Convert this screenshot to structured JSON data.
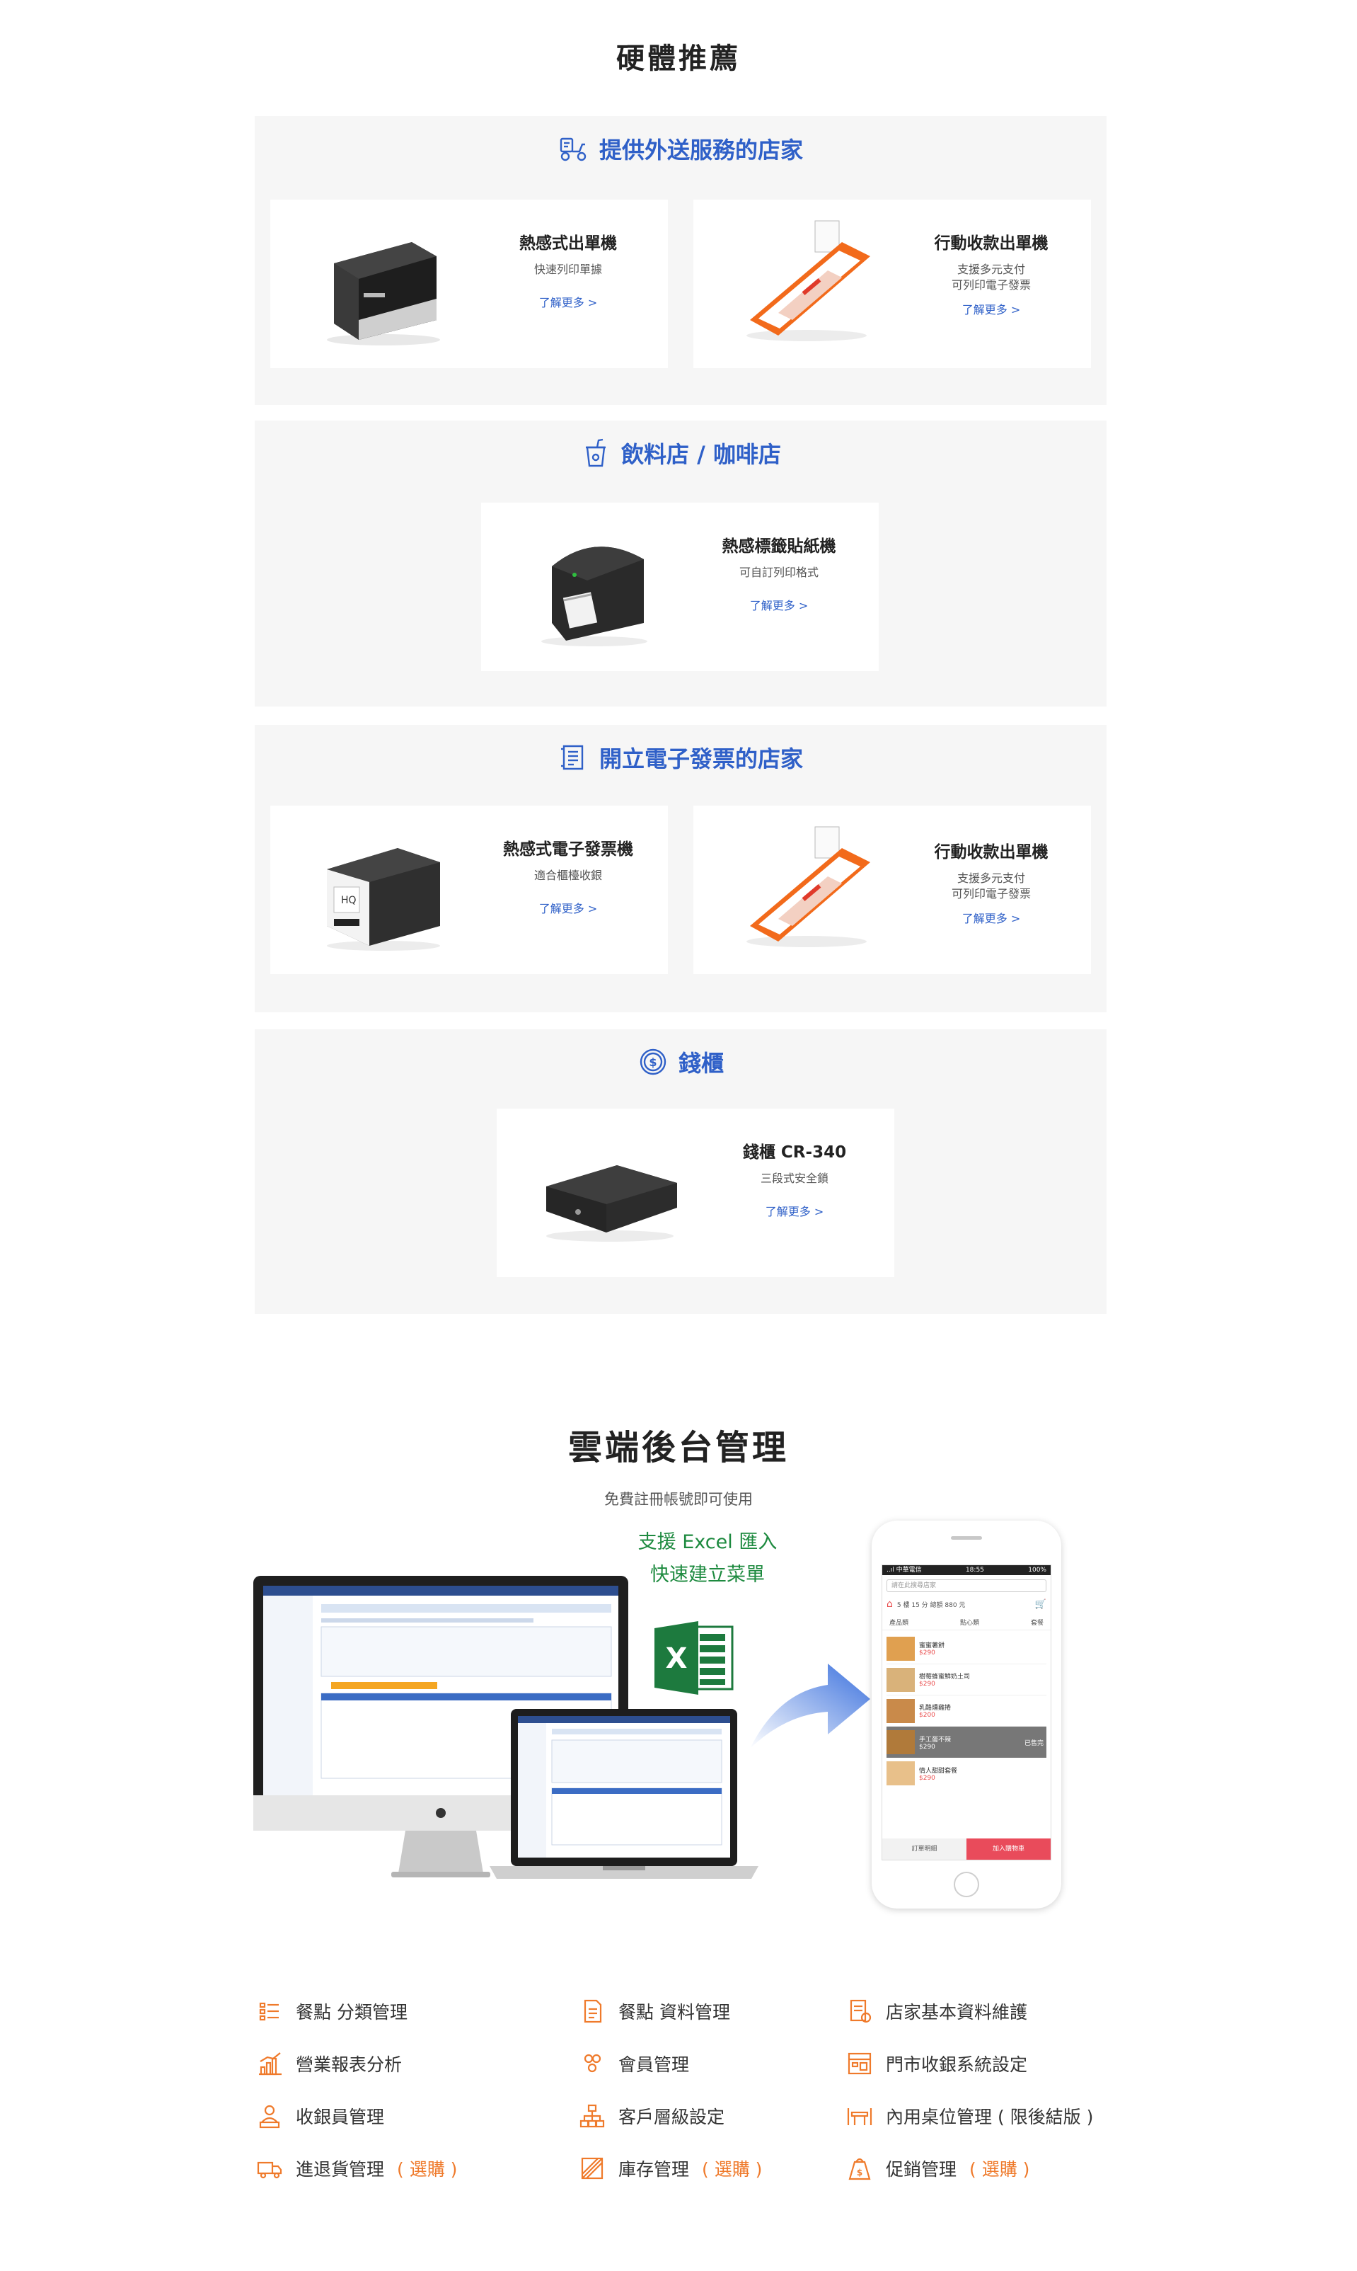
{
  "hardware": {
    "title": "硬體推薦",
    "more_label": "了解更多 >",
    "groups": [
      {
        "title": "提供外送服務的店家",
        "icon": "scooter-icon",
        "cards": [
          {
            "name": "熱感式出單機",
            "desc1": "快速列印單據",
            "desc2": "",
            "image": "thermal-receipt-printer"
          },
          {
            "name": "行動收款出單機",
            "desc1": "支援多元支付",
            "desc2": "可列印電子發票",
            "image": "mobile-payment-pos"
          }
        ]
      },
      {
        "title": "飲料店 / 咖啡店",
        "icon": "drink-cup-icon",
        "cards": [
          {
            "name": "熱感標籤貼紙機",
            "desc1": "可自訂列印格式",
            "desc2": "",
            "image": "thermal-label-printer"
          }
        ]
      },
      {
        "title": "開立電子發票的店家",
        "icon": "invoice-icon",
        "cards": [
          {
            "name": "熱感式電子發票機",
            "desc1": "適合櫃檯收銀",
            "desc2": "",
            "image": "e-invoice-printer"
          },
          {
            "name": "行動收款出單機",
            "desc1": "支援多元支付",
            "desc2": "可列印電子發票",
            "image": "mobile-payment-pos"
          }
        ]
      },
      {
        "title": "錢櫃",
        "icon": "dollar-coin-icon",
        "cards": [
          {
            "name": "錢櫃 CR-340",
            "desc1": "三段式安全鎖",
            "desc2": "",
            "image": "cash-drawer"
          }
        ]
      }
    ]
  },
  "cloud": {
    "title": "雲端後台管理",
    "subtitle": "免費註冊帳號即可使用",
    "excel_line1": "支援 Excel 匯入",
    "excel_line2": "快速建立菜單",
    "phone": {
      "status_carrier": "..ıl 中華電信",
      "status_time": "18:55",
      "status_battery": "100%",
      "search_placeholder": "請在此搜尋店家",
      "delivery_info": "5 樓 15 分 總額 880 元",
      "tabs": [
        "產品類",
        "點心類",
        "套餐"
      ],
      "items": [
        {
          "name": "蜜蜜薯餅",
          "price": "$290"
        },
        {
          "name": "樹莓蜂蜜鮮奶土司",
          "price": "$290"
        },
        {
          "name": "乳酪燻雞捲",
          "price": "$200"
        },
        {
          "name": "手工蛋不辣",
          "price": "$290"
        },
        {
          "name": "情人甜甜套餐",
          "price": "$290"
        }
      ],
      "sold_out_label": "已售完",
      "bottom_left": "訂單明細",
      "bottom_right": "加入購物車"
    },
    "features": [
      {
        "label": "餐點 分類管理",
        "option": "",
        "icon": "list-icon"
      },
      {
        "label": "營業報表分析",
        "option": "",
        "icon": "bar-chart-icon"
      },
      {
        "label": "收銀員管理",
        "option": "",
        "icon": "cashier-icon"
      },
      {
        "label": "進退貨管理",
        "option": "( 選購 )",
        "icon": "delivery-truck-icon"
      },
      {
        "label": "餐點 資料管理",
        "option": "",
        "icon": "document-icon"
      },
      {
        "label": "會員管理",
        "option": "",
        "icon": "members-icon"
      },
      {
        "label": "客戶層級設定",
        "option": "",
        "icon": "hierarchy-icon"
      },
      {
        "label": "庫存管理",
        "option": "( 選購 )",
        "icon": "inventory-icon"
      },
      {
        "label": "店家基本資料維護",
        "option": "",
        "icon": "store-info-icon"
      },
      {
        "label": "門市收銀系統設定",
        "option": "",
        "icon": "pos-settings-icon"
      },
      {
        "label": "內用桌位管理 ( 限後結版 )",
        "option": "",
        "icon": "table-icon"
      },
      {
        "label": "促銷管理",
        "option": "( 選購 )",
        "icon": "promotion-bag-icon"
      }
    ]
  },
  "colors": {
    "accent_blue": "#2f60c8",
    "accent_orange": "#ef7a2b",
    "panel_bg": "#f6f6f6"
  }
}
